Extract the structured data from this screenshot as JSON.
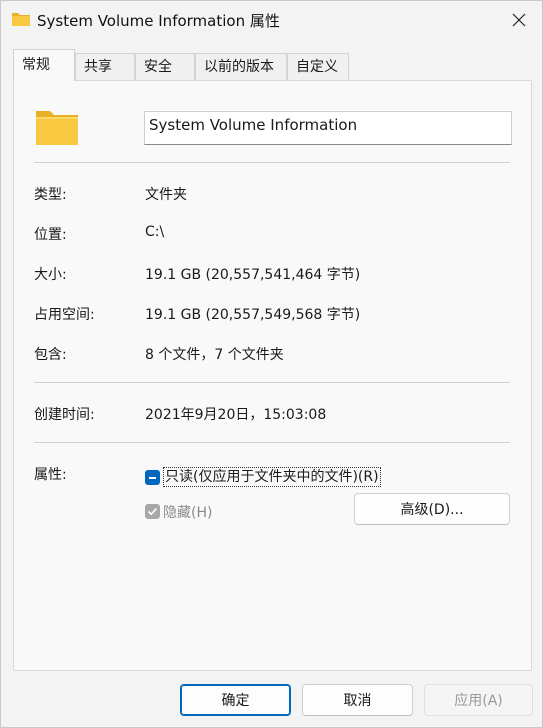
{
  "window": {
    "title": "System Volume Information 属性",
    "icon": "folder-icon",
    "close_icon": "close-icon"
  },
  "tabs": [
    {
      "label": "常规",
      "active": true
    },
    {
      "label": "共享",
      "active": false
    },
    {
      "label": "安全",
      "active": false
    },
    {
      "label": "以前的版本",
      "active": false
    },
    {
      "label": "自定义",
      "active": false
    }
  ],
  "general": {
    "name_value": "System Volume Information",
    "rows": [
      {
        "label": "类型:",
        "value": "文件夹"
      },
      {
        "label": "位置:",
        "value": "C:\\"
      },
      {
        "label": "大小:",
        "value": "19.1 GB (20,557,541,464 字节)"
      },
      {
        "label": "占用空间:",
        "value": "19.1 GB (20,557,549,568 字节)"
      },
      {
        "label": "包含:",
        "value": "8 个文件，7 个文件夹"
      },
      {
        "label": "创建时间:",
        "value": "2021年9月20日，15:03:08"
      }
    ],
    "attributes_label": "属性:",
    "readonly_label": "只读(仅应用于文件夹中的文件)(R)",
    "hidden_label": "隐藏(H)",
    "advanced_button": "高级(D)..."
  },
  "footer": {
    "ok": "确定",
    "cancel": "取消",
    "apply": "应用(A)"
  },
  "colors": {
    "accent": "#0067c0",
    "folder": "#f8c840",
    "folder_dark": "#e8b028"
  }
}
